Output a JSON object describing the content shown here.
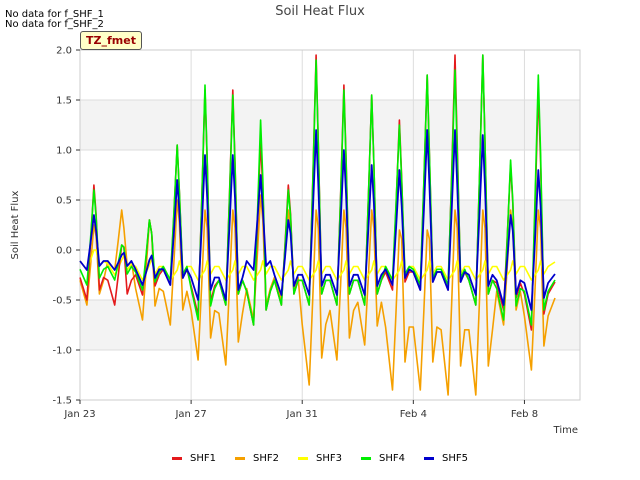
{
  "notes": [
    "No data for f_SHF_1",
    "No data for f_SHF_2"
  ],
  "tz_label": "TZ_fmet",
  "chart_data": {
    "type": "line",
    "title": "Soil Heat Flux",
    "xlabel": "Time",
    "ylabel": "Soil Heat Flux",
    "ylim": [
      -1.5,
      2.0
    ],
    "yticks": [
      -1.5,
      -1.0,
      -0.5,
      0.0,
      0.5,
      1.0,
      1.5,
      2.0
    ],
    "ytick_labels": [
      "-1.5",
      "-1.0",
      "-0.5",
      "0.0",
      "0.5",
      "1.0",
      "1.5",
      "2.0"
    ],
    "xlim_days": [
      0,
      18
    ],
    "xticks": [
      {
        "day": 0,
        "label": "Jan 23"
      },
      {
        "day": 4,
        "label": "Jan 27"
      },
      {
        "day": 8,
        "label": "Jan 31"
      },
      {
        "day": 12,
        "label": "Feb 4"
      },
      {
        "day": 16,
        "label": "Feb 8"
      }
    ],
    "grid": true,
    "legend_position": "bottom",
    "days": [
      0,
      1,
      2,
      3,
      4,
      5,
      6,
      7,
      8,
      9,
      10,
      11,
      12,
      13,
      14,
      15,
      16
    ],
    "series": [
      {
        "name": "SHF1",
        "color": "#e41a1c",
        "daily_peak": [
          0.65,
          0.05,
          0.3,
          1.05,
          1.6,
          1.6,
          1.1,
          0.65,
          1.95,
          1.65,
          1.55,
          1.3,
          1.75,
          1.95,
          1.95,
          0.85,
          1.6
        ],
        "daily_min": [
          -0.5,
          -0.55,
          -0.45,
          -0.35,
          -0.65,
          -0.55,
          -0.75,
          -0.55,
          -0.55,
          -0.55,
          -0.55,
          -0.4,
          -0.4,
          -0.4,
          -0.55,
          -0.6,
          -0.8
        ]
      },
      {
        "name": "SHF2",
        "color": "#f5a000",
        "daily_peak": [
          0.25,
          0.4,
          0.3,
          0.5,
          0.4,
          0.4,
          0.55,
          0.4,
          0.4,
          0.4,
          0.4,
          0.2,
          0.2,
          0.4,
          0.4,
          0.4,
          0.4
        ],
        "daily_min": [
          -0.55,
          -0.2,
          -0.7,
          -0.75,
          -1.1,
          -1.15,
          -0.7,
          -0.5,
          -1.35,
          -1.1,
          -0.95,
          -1.4,
          -1.4,
          -1.45,
          -1.45,
          -0.75,
          -1.2
        ]
      },
      {
        "name": "SHF3",
        "color": "#ffff00",
        "daily_peak": [
          0.0,
          -0.1,
          -0.15,
          -0.2,
          -0.2,
          -0.2,
          -0.2,
          -0.2,
          -0.2,
          -0.2,
          -0.2,
          -0.2,
          -0.2,
          -0.2,
          -0.2,
          -0.2,
          -0.2
        ],
        "daily_min": [
          -0.2,
          -0.25,
          -0.3,
          -0.3,
          -0.3,
          -0.3,
          -0.3,
          -0.3,
          -0.3,
          -0.3,
          -0.3,
          -0.3,
          -0.3,
          -0.3,
          -0.3,
          -0.3,
          -0.3
        ]
      },
      {
        "name": "SHF4",
        "color": "#00ee00",
        "daily_peak": [
          0.6,
          0.05,
          0.3,
          1.05,
          1.65,
          1.55,
          1.3,
          0.6,
          1.9,
          1.6,
          1.55,
          1.25,
          1.75,
          1.8,
          1.95,
          0.9,
          1.75
        ],
        "daily_min": [
          -0.35,
          -0.3,
          -0.4,
          -0.3,
          -0.7,
          -0.55,
          -0.75,
          -0.55,
          -0.55,
          -0.55,
          -0.55,
          -0.3,
          -0.35,
          -0.35,
          -0.55,
          -0.7,
          -0.75
        ]
      },
      {
        "name": "SHF5",
        "color": "#0000cc",
        "daily_peak": [
          0.35,
          -0.05,
          -0.1,
          0.7,
          0.95,
          0.95,
          0.75,
          0.3,
          1.2,
          1.0,
          0.85,
          0.8,
          1.2,
          1.2,
          1.15,
          0.35,
          0.8
        ],
        "daily_min": [
          -0.2,
          -0.2,
          -0.35,
          -0.35,
          -0.5,
          -0.5,
          -0.2,
          -0.45,
          -0.45,
          -0.45,
          -0.45,
          -0.35,
          -0.4,
          -0.4,
          -0.45,
          -0.55,
          -0.6
        ]
      }
    ]
  }
}
